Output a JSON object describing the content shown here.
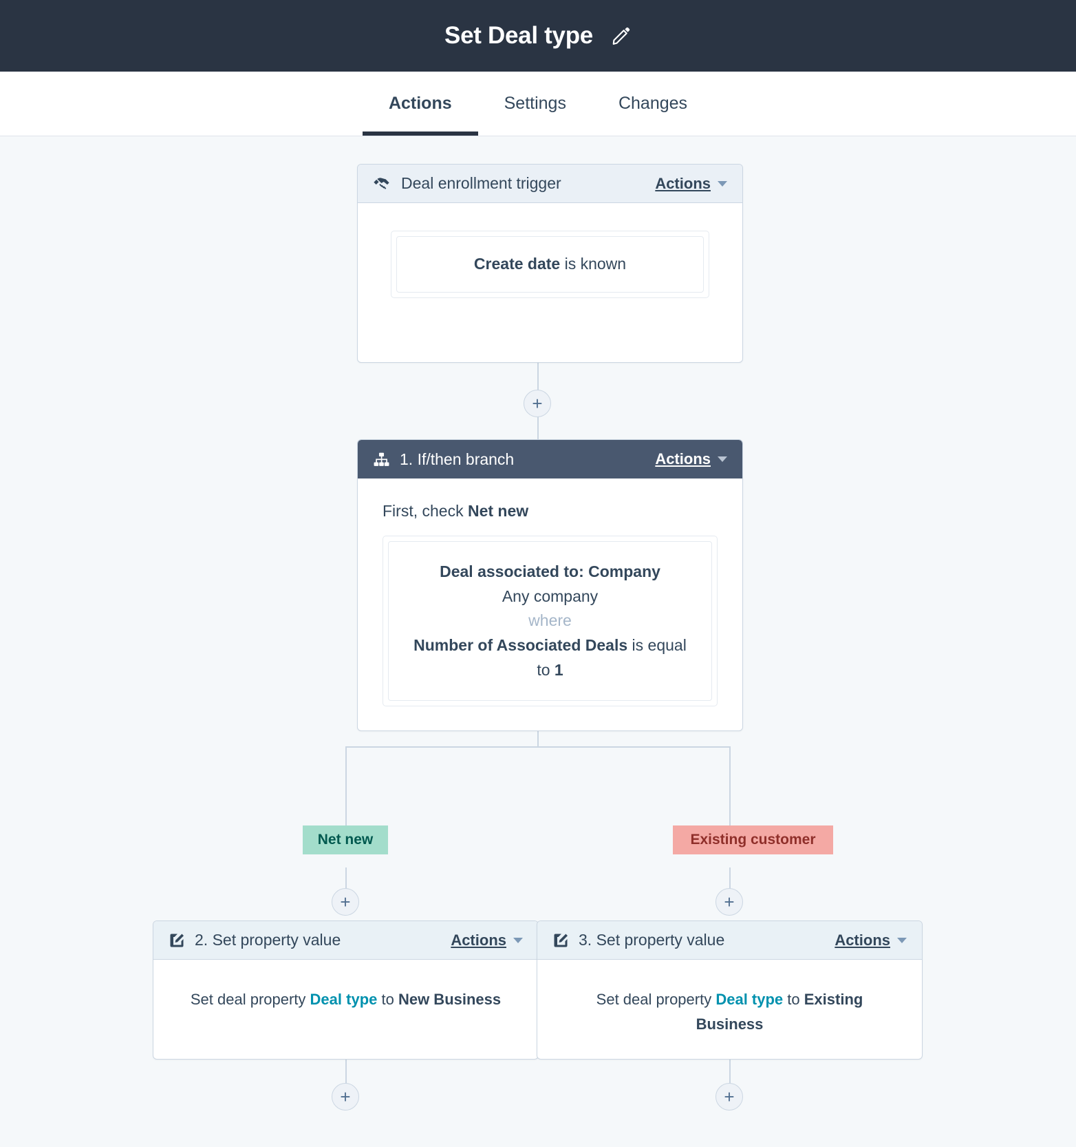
{
  "header": {
    "title": "Set Deal type",
    "edit_icon": "pencil-icon"
  },
  "tabs": [
    {
      "label": "Actions",
      "active": true
    },
    {
      "label": "Settings",
      "active": false
    },
    {
      "label": "Changes",
      "active": false
    }
  ],
  "colors": {
    "topbar": "#2a3443",
    "canvas": "#f5f8fa",
    "branch_header": "#49586f",
    "trigger_header": "#eaf0f6",
    "action_header": "#e9f1f6",
    "connector": "#cbd6e2",
    "link_teal": "#0091ae",
    "pill_green_bg": "#a3ddcb",
    "pill_green_text": "#00594f",
    "pill_red_bg": "#f4a9a4",
    "pill_red_text": "#8f2f2a"
  },
  "trigger": {
    "icon": "handshake-icon",
    "title": "Deal enrollment trigger",
    "actions_label": "Actions",
    "condition": {
      "bold": "Create date",
      "rest": " is known"
    }
  },
  "branch": {
    "icon": "sitemap-icon",
    "title": "1. If/then branch",
    "actions_label": "Actions",
    "lead_prefix": "First, check ",
    "lead_bold": "Net new",
    "condition": {
      "line1": "Deal associated to: Company",
      "line2": "Any company",
      "line3": "where",
      "line4_bold": "Number of Associated Deals",
      "line4_rest": " is equal",
      "line5_prefix": "to ",
      "line5_bold": "1"
    }
  },
  "branch_labels": {
    "left": "Net new",
    "right": "Existing customer"
  },
  "actions": [
    {
      "icon": "edit-square-icon",
      "title": "2. Set property value",
      "actions_label": "Actions",
      "body_prefix": "Set deal property ",
      "body_property": "Deal type",
      "body_middle": " to ",
      "body_value": "New Business"
    },
    {
      "icon": "edit-square-icon",
      "title": "3. Set property value",
      "actions_label": "Actions",
      "body_prefix": "Set deal property ",
      "body_property": "Deal type",
      "body_middle": " to ",
      "body_value": "Existing Business"
    }
  ],
  "plus_buttons": {
    "label": "+",
    "name": "add-action-button"
  }
}
